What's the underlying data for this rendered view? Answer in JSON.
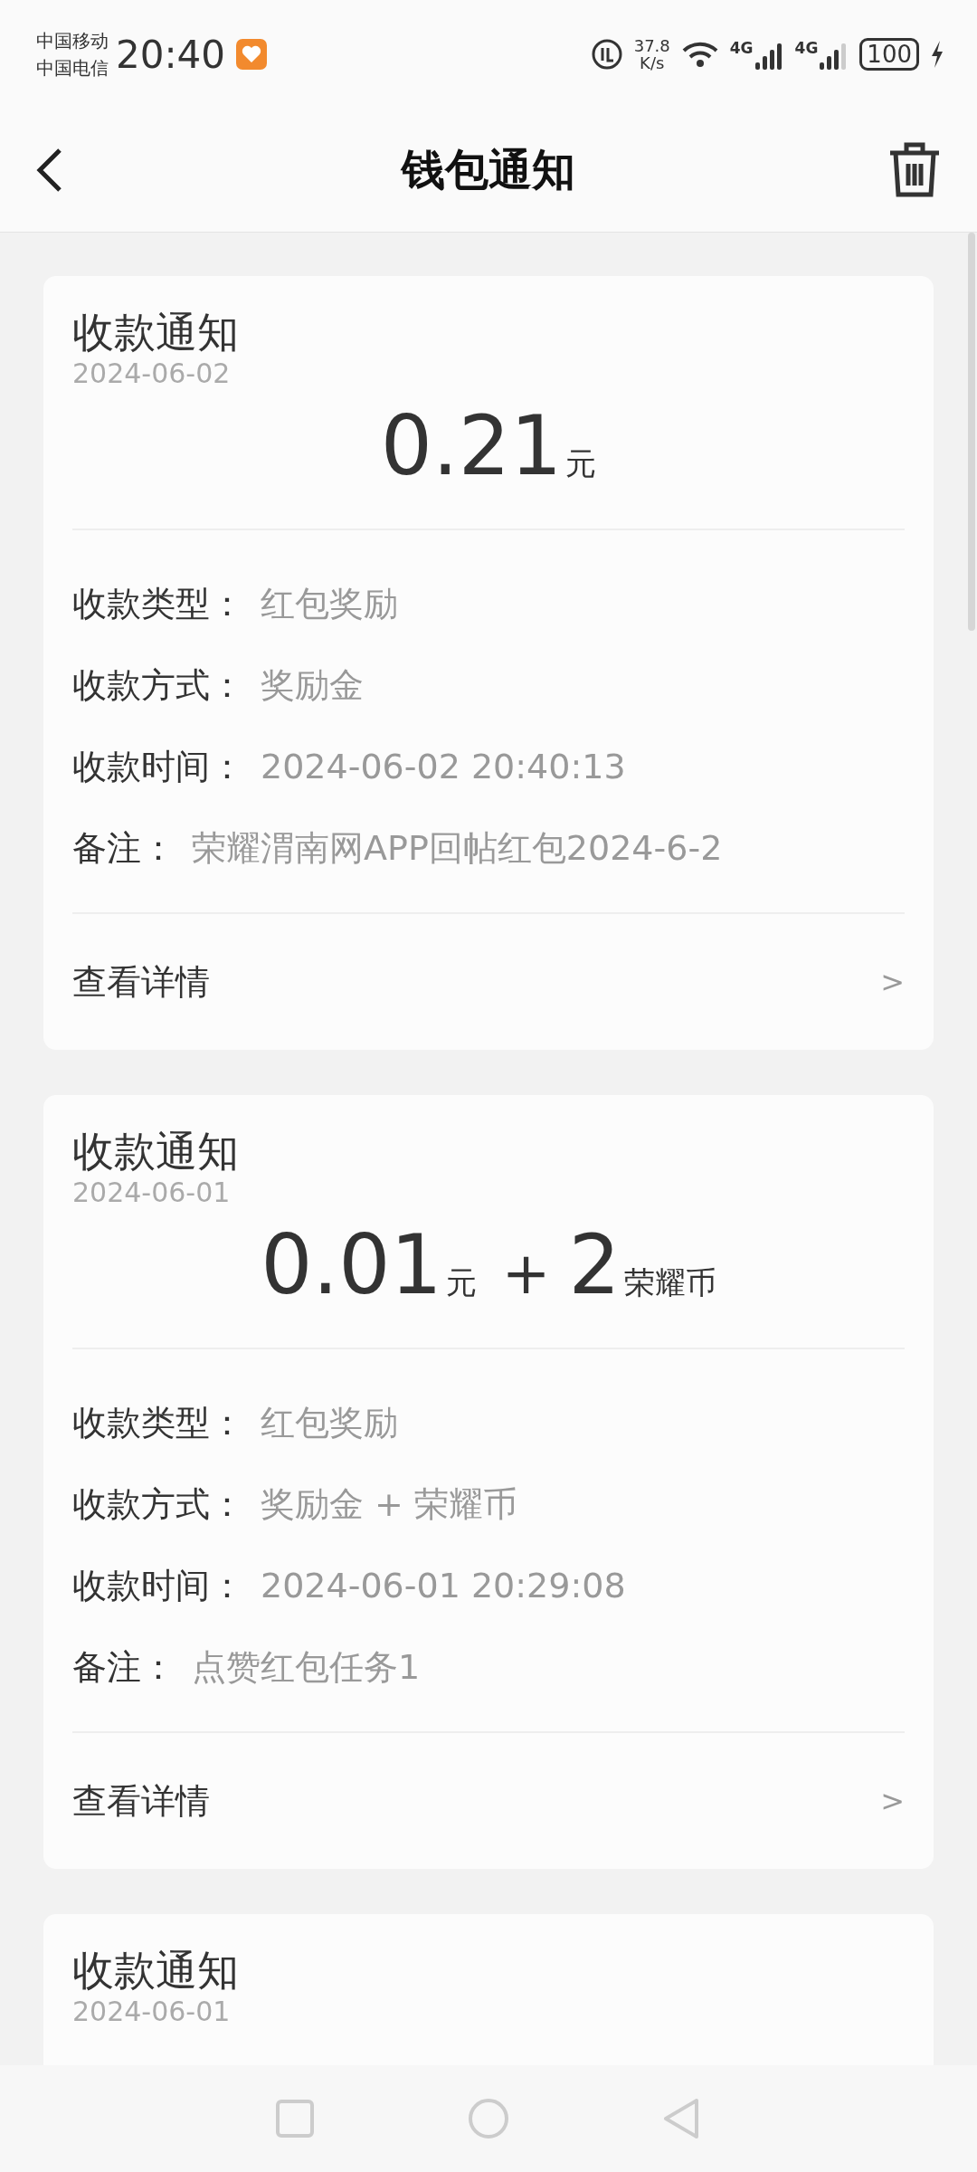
{
  "status_bar": {
    "carriers": [
      "中国移动",
      "中国电信"
    ],
    "time": "20:40",
    "speed_value": "37.8",
    "speed_unit": "K/s",
    "signals": [
      {
        "label": "4G",
        "kind": "full"
      },
      {
        "label": "4G",
        "kind": "partial"
      }
    ],
    "battery": "100"
  },
  "header": {
    "title": "钱包通知"
  },
  "cards": [
    {
      "title": "收款通知",
      "date": "2024-06-02",
      "amount": [
        {
          "number": "0.21",
          "unit": "元"
        }
      ],
      "rows": [
        {
          "label": "收款类型：",
          "value": "红包奖励"
        },
        {
          "label": "收款方式：",
          "value": "奖励金"
        },
        {
          "label": "收款时间：",
          "value": "2024-06-02 20:40:13"
        },
        {
          "label": "备注：",
          "value": "荣耀渭南网APP回帖红包2024-6-2"
        }
      ],
      "link": {
        "label": "查看详情",
        "arrow": ">"
      }
    },
    {
      "title": "收款通知",
      "date": "2024-06-01",
      "amount": [
        {
          "number": "0.01",
          "unit": "元"
        },
        {
          "prefix": "+",
          "number": "2",
          "unit": "荣耀币"
        }
      ],
      "rows": [
        {
          "label": "收款类型：",
          "value": "红包奖励"
        },
        {
          "label": "收款方式：",
          "value": "奖励金 + 荣耀币"
        },
        {
          "label": "收款时间：",
          "value": "2024-06-01 20:29:08"
        },
        {
          "label": "备注：",
          "value": "点赞红包任务1"
        }
      ],
      "link": {
        "label": "查看详情",
        "arrow": ">"
      }
    },
    {
      "title": "收款通知",
      "date": "2024-06-01"
    }
  ]
}
